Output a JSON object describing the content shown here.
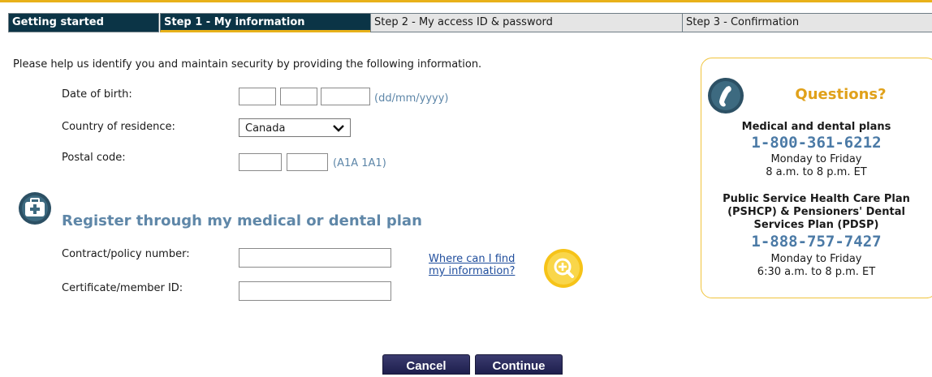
{
  "steps": {
    "getting_started": "Getting started",
    "step1": "Step 1 - My information",
    "step2": "Step 2 - My access ID & password",
    "step3": "Step 3 - Confirmation"
  },
  "intro": "Please help us identify you and maintain security by providing the following information.",
  "identity": {
    "dob_label": "Date of birth:",
    "dob_hint": "(dd/mm/yyyy)",
    "country_label": "Country of residence:",
    "country_value": "Canada",
    "postal_label": "Postal code:",
    "postal_hint": "(A1A 1A1)"
  },
  "plan": {
    "title": "Register through my medical or dental plan",
    "contract_label": "Contract/policy number:",
    "certificate_label": "Certificate/member ID:",
    "find_link_line1": "Where can I find",
    "find_link_line2": "my information?"
  },
  "buttons": {
    "cancel": "Cancel",
    "continue": "Continue"
  },
  "questions": {
    "title": "Questions?",
    "medical_heading": "Medical and dental plans",
    "medical_phone": "1-800-361-6212",
    "medical_days": "Monday to Friday",
    "medical_hours": "8 a.m. to 8 p.m. ET",
    "pshcp_line1": "Public Service Health Care Plan",
    "pshcp_line2": "(PSHCP) & Pensioners' Dental",
    "pshcp_line3": "Services Plan (PDSP)",
    "pshcp_phone": "1-888-757-7427",
    "pshcp_days": "Monday to Friday",
    "pshcp_hours": "6:30 a.m. to 8 p.m. ET"
  },
  "colors": {
    "accent": "#e8b11a",
    "navy": "#0b3446",
    "link": "#1f4d9c",
    "hint": "#5d86a8"
  }
}
